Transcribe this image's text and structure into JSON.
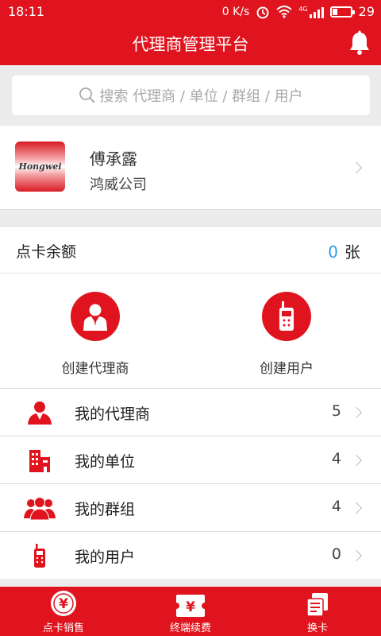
{
  "status_bar": {
    "time": "18:11",
    "net_speed": "0 K/s",
    "signal": "4G",
    "battery": "29"
  },
  "header": {
    "title": "代理商管理平台"
  },
  "search": {
    "placeholder": "搜索 代理商 / 单位 / 群组 / 用户"
  },
  "profile": {
    "logo_text": "Hongwei",
    "name": "傅承露",
    "company": "鸿威公司"
  },
  "balance": {
    "label": "点卡余额",
    "value": "0",
    "unit": "张"
  },
  "actions": [
    {
      "label": "创建代理商",
      "icon": "agent-icon"
    },
    {
      "label": "创建用户",
      "icon": "walkie-talkie-icon"
    }
  ],
  "menu": [
    {
      "label": "我的代理商",
      "count": "5",
      "icon": "person-icon"
    },
    {
      "label": "我的单位",
      "count": "4",
      "icon": "building-icon"
    },
    {
      "label": "我的群组",
      "count": "4",
      "icon": "group-icon"
    },
    {
      "label": "我的用户",
      "count": "0",
      "icon": "walkie-talkie-icon"
    }
  ],
  "tabs": [
    {
      "label": "点卡销售",
      "icon": "yuan-coin-icon"
    },
    {
      "label": "终端续费",
      "icon": "yuan-ticket-icon"
    },
    {
      "label": "换卡",
      "icon": "swap-card-icon"
    }
  ],
  "colors": {
    "brand": "#e0141e",
    "accent": "#2e9ee8"
  }
}
